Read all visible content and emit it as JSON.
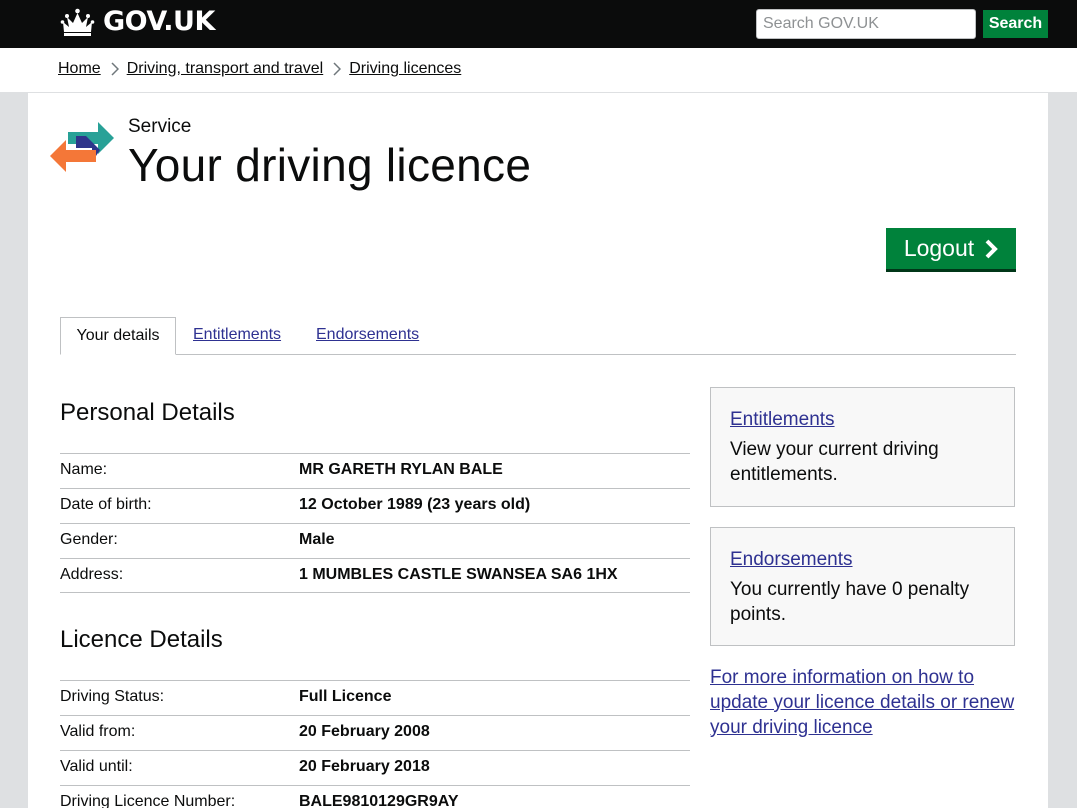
{
  "header": {
    "logo_text": "GOV.UK",
    "search_placeholder": "Search GOV.UK",
    "search_button": "Search"
  },
  "breadcrumb": [
    "Home",
    "Driving, transport and travel",
    "Driving licences"
  ],
  "service": {
    "label": "Service",
    "title": "Your driving licence",
    "logout_label": "Logout"
  },
  "tabs": [
    "Your details",
    "Entitlements",
    "Endorsements"
  ],
  "personal": {
    "heading": "Personal Details",
    "rows": [
      {
        "label": "Name:",
        "value": "MR GARETH RYLAN BALE"
      },
      {
        "label": "Date of birth:",
        "value": "12 October 1989 (23 years old)"
      },
      {
        "label": "Gender:",
        "value": "Male"
      },
      {
        "label": "Address:",
        "value": "1 MUMBLES CASTLE SWANSEA SA6 1HX"
      }
    ]
  },
  "licence": {
    "heading": "Licence Details",
    "rows": [
      {
        "label": "Driving Status:",
        "value": "Full Licence"
      },
      {
        "label": "Valid from:",
        "value": "20 February 2008"
      },
      {
        "label": "Valid until:",
        "value": "20 February 2018"
      },
      {
        "label": "Driving Licence Number:",
        "value": "BALE9810129GR9AY"
      }
    ]
  },
  "side": {
    "entitlements_link": "Entitlements",
    "entitlements_text": "View your current driving entitlements.",
    "endorsements_link": "Endorsements",
    "endorsements_text": "You currently have 0 penalty points.",
    "more_info": "For more information on how to update your licence details or renew your driving licence"
  },
  "colors": {
    "header_bg": "#0b0c0c",
    "button_green": "#00823b",
    "link": "#2e3191",
    "border": "#bfc1c3"
  }
}
